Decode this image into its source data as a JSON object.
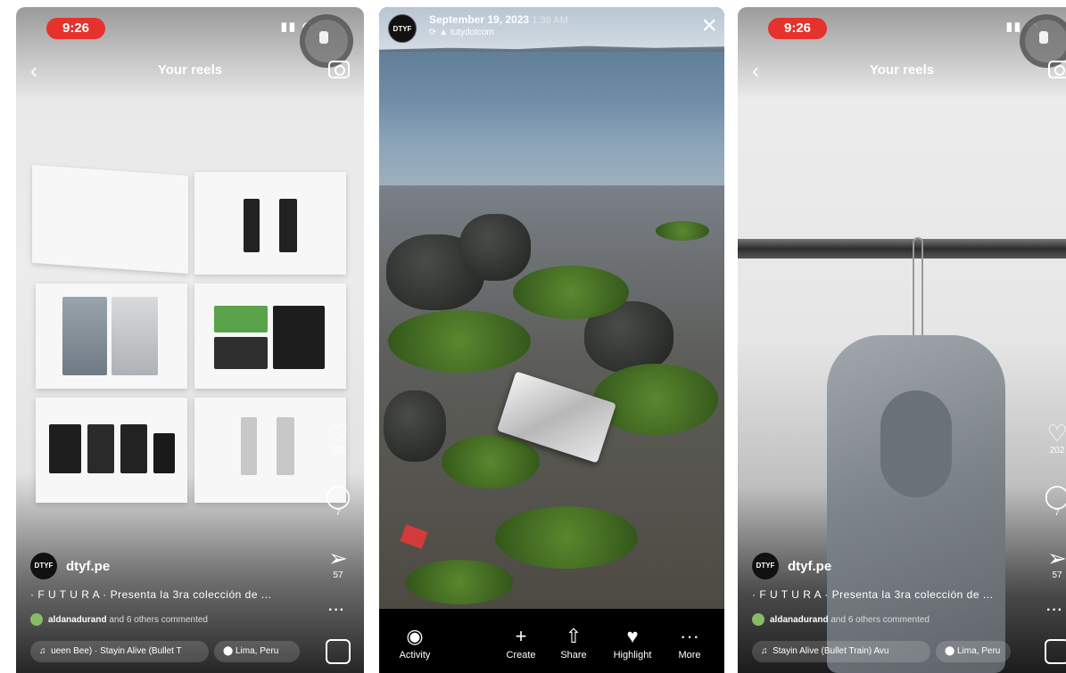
{
  "left_reel": {
    "status_time": "9:26",
    "header_title": "Your reels",
    "likes": "202",
    "comments": "7",
    "shares": "57",
    "author": "dtyf.pe",
    "avatar_text": "DTYF",
    "caption": "· F U T U R A · Presenta la 3ra colección de ...",
    "commenter": "aldanadurand",
    "commented_text": " and 6 others commented",
    "audio": "ueen Bee) · Stayin Alive (Bullet T",
    "location": "Lima, Peru",
    "poster_brand": "DTYF"
  },
  "story": {
    "avatar_text": "DTYF",
    "date": "September 19, 2023",
    "time": "1:36 AM",
    "username": "tutydotcom",
    "actions": [
      {
        "label": "Activity",
        "icon": "eye-icon"
      },
      {
        "label": "Create",
        "icon": "plus-icon"
      },
      {
        "label": "Share",
        "icon": "share-icon"
      },
      {
        "label": "Highlight",
        "icon": "heart-circle-icon"
      },
      {
        "label": "More",
        "icon": "dots-icon"
      }
    ]
  },
  "right_reel": {
    "status_time": "9:26",
    "header_title": "Your reels",
    "likes": "202",
    "comments": "7",
    "shares": "57",
    "author": "dtyf.pe",
    "avatar_text": "DTYF",
    "caption": "· F U T U R A · Presenta la 3ra colección de ...",
    "commenter": "aldanadurand",
    "commented_text": " and 6 others commented",
    "audio": "Stayin Alive (Bullet Train)  Avu",
    "location": "Lima, Peru"
  }
}
